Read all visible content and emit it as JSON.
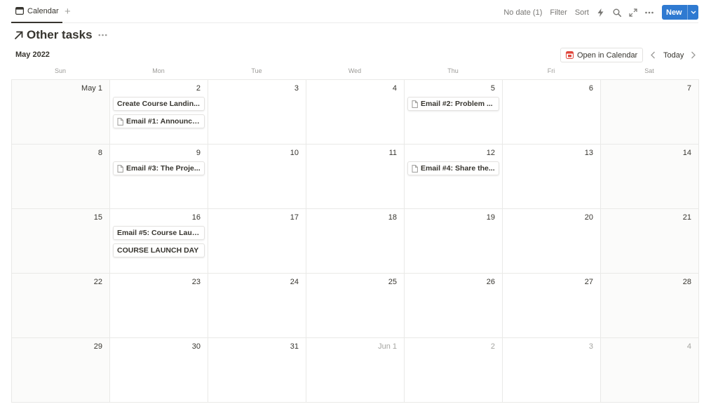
{
  "tab": {
    "label": "Calendar",
    "add": "+"
  },
  "toolbar": {
    "no_date": "No date (1)",
    "filter": "Filter",
    "sort": "Sort",
    "new_label": "New"
  },
  "page": {
    "title": "Other tasks"
  },
  "calendar": {
    "month": "May 2022",
    "open_in_calendar": "Open in Calendar",
    "today": "Today",
    "weekdays": [
      "Sun",
      "Mon",
      "Tue",
      "Wed",
      "Thu",
      "Fri",
      "Sat"
    ],
    "weeks": [
      [
        {
          "num": "May 1",
          "weekend": true,
          "events": []
        },
        {
          "num": "2",
          "events": [
            {
              "text": "Create Course Landin...",
              "doc": false
            },
            {
              "text": "Email #1: Announce...",
              "doc": true
            }
          ]
        },
        {
          "num": "3",
          "events": []
        },
        {
          "num": "4",
          "events": []
        },
        {
          "num": "5",
          "events": [
            {
              "text": "Email #2: Problem ...",
              "doc": true
            }
          ]
        },
        {
          "num": "6",
          "events": []
        },
        {
          "num": "7",
          "weekend": true,
          "events": []
        }
      ],
      [
        {
          "num": "8",
          "weekend": true,
          "events": []
        },
        {
          "num": "9",
          "events": [
            {
              "text": "Email #3: The Proje...",
              "doc": true
            }
          ]
        },
        {
          "num": "10",
          "events": []
        },
        {
          "num": "11",
          "events": []
        },
        {
          "num": "12",
          "events": [
            {
              "text": "Email #4: Share the...",
              "doc": true
            }
          ]
        },
        {
          "num": "13",
          "events": []
        },
        {
          "num": "14",
          "weekend": true,
          "events": []
        }
      ],
      [
        {
          "num": "15",
          "weekend": true,
          "events": []
        },
        {
          "num": "16",
          "events": [
            {
              "text": "Email #5: Course Laun...",
              "doc": false
            },
            {
              "text": "COURSE LAUNCH DAY",
              "doc": false
            }
          ]
        },
        {
          "num": "17",
          "events": []
        },
        {
          "num": "18",
          "events": []
        },
        {
          "num": "19",
          "events": []
        },
        {
          "num": "20",
          "events": []
        },
        {
          "num": "21",
          "weekend": true,
          "events": []
        }
      ],
      [
        {
          "num": "22",
          "weekend": true,
          "events": []
        },
        {
          "num": "23",
          "events": []
        },
        {
          "num": "24",
          "events": []
        },
        {
          "num": "25",
          "events": []
        },
        {
          "num": "26",
          "events": []
        },
        {
          "num": "27",
          "events": []
        },
        {
          "num": "28",
          "weekend": true,
          "events": []
        }
      ],
      [
        {
          "num": "29",
          "weekend": true,
          "events": []
        },
        {
          "num": "30",
          "events": []
        },
        {
          "num": "31",
          "events": []
        },
        {
          "num": "Jun 1",
          "muted": true,
          "events": []
        },
        {
          "num": "2",
          "muted": true,
          "events": []
        },
        {
          "num": "3",
          "muted": true,
          "events": []
        },
        {
          "num": "4",
          "muted": true,
          "weekend": true,
          "events": []
        }
      ]
    ]
  },
  "icons": {
    "tab": "calendar-icon",
    "bolt": "lightning-icon",
    "search": "search-icon",
    "expand": "expand-icon",
    "more": "more-icon",
    "title_arrow": "arrow-up-right-icon",
    "google_calendar": "google-calendar-icon",
    "doc": "document-icon"
  },
  "colors": {
    "accent": "#2f7ad1",
    "weekend_bg": "#fbfbfa",
    "calendar_icon": "#e0463b"
  }
}
